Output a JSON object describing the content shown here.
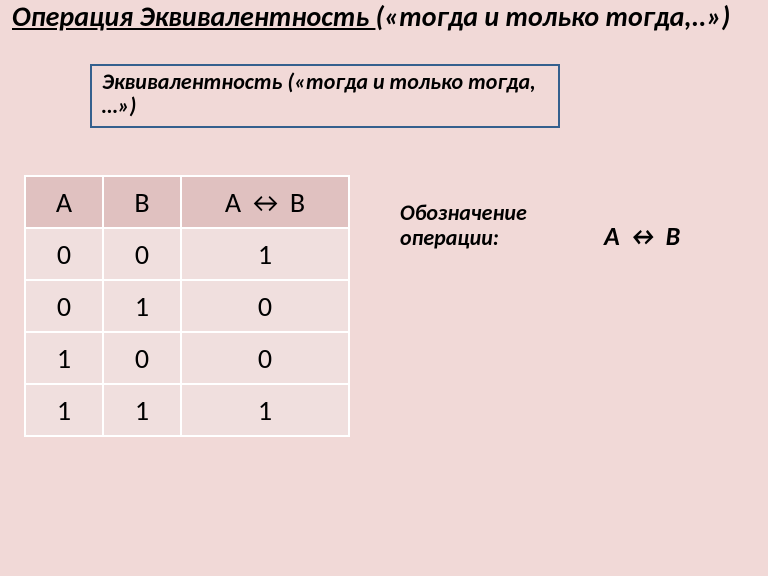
{
  "title": {
    "underlined": "Операция  Эквивалентность ",
    "rest": "(«тогда и только тогда,..»)"
  },
  "callout": "Эквивалентность («тогда и только тогда, …»)",
  "table": {
    "headers": {
      "a": "A",
      "b": "B",
      "result": "A ↔ B"
    },
    "rows": [
      {
        "a": "0",
        "b": "0",
        "r": "1"
      },
      {
        "a": "0",
        "b": "1",
        "r": "0"
      },
      {
        "a": "1",
        "b": "0",
        "r": "0"
      },
      {
        "a": "1",
        "b": "1",
        "r": "1"
      }
    ]
  },
  "notation": {
    "label": "Обозначение операции:",
    "value": "A ↔ B"
  },
  "chart_data": {
    "type": "table",
    "title": "Truth table for equivalence (A ↔ B)",
    "columns": [
      "A",
      "B",
      "A ↔ B"
    ],
    "rows": [
      [
        0,
        0,
        1
      ],
      [
        0,
        1,
        0
      ],
      [
        1,
        0,
        0
      ],
      [
        1,
        1,
        1
      ]
    ]
  }
}
